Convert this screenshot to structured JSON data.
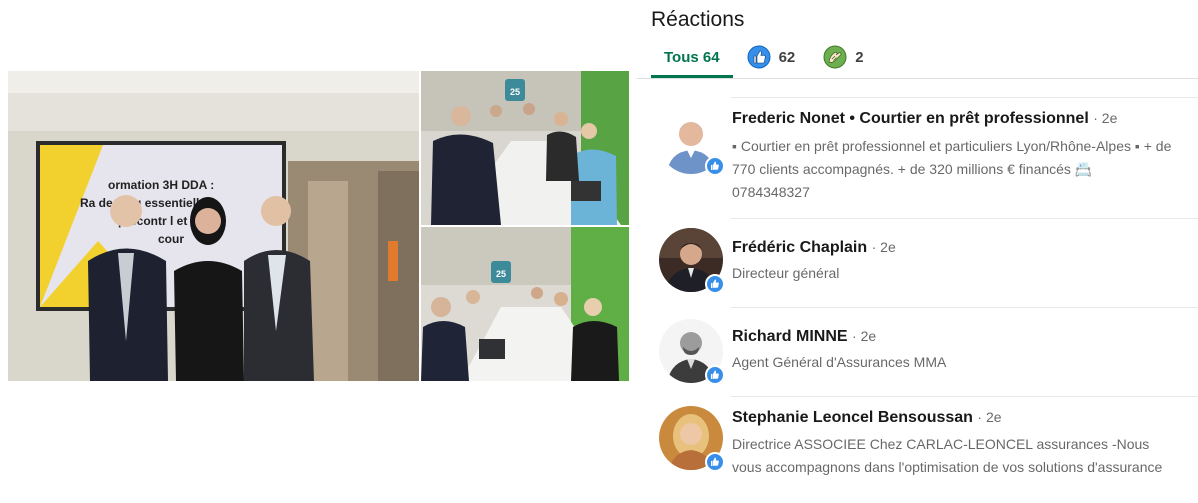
{
  "reactions": {
    "title": "Réactions",
    "tabs": [
      {
        "label": "Tous 64",
        "icon": "all",
        "active": true
      },
      {
        "label": "62",
        "icon": "like-icon",
        "color": "#378fe9"
      },
      {
        "label": "2",
        "icon": "support-icon",
        "color": "#6dae4f"
      }
    ],
    "people": [
      {
        "name": "Frederic Nonet • Courtier en prêt professionnel",
        "degree": "· 2e",
        "headline": "▪ Courtier en prêt professionnel et particuliers Lyon/Rhône-Alpes ▪ + de 770 clients accompagnés. + de 320 millions € financés 📇 0784348327",
        "reaction": "like-icon"
      },
      {
        "name": "Frédéric Chaplain",
        "degree": "· 2e",
        "headline": "Directeur général",
        "reaction": "like-icon"
      },
      {
        "name": "Richard MINNE",
        "degree": "· 2e",
        "headline": "Agent Général d'Assurances MMA",
        "reaction": "like-icon"
      },
      {
        "name": "Stephanie Leoncel Bensoussan",
        "degree": "· 2e",
        "headline": "Directrice ASSOCIEE Chez CARLAC-LEONCEL assurances -Nous vous accompagnons dans l'optimisation de vos solutions d'assurance",
        "reaction": "like-icon"
      }
    ]
  },
  "photos": {
    "main_screen_text": [
      "ormation 3H DDA :",
      "Ra    des règ   essentielle",
      "précontr      l et du",
      "cour"
    ],
    "sticker_label": "25"
  }
}
